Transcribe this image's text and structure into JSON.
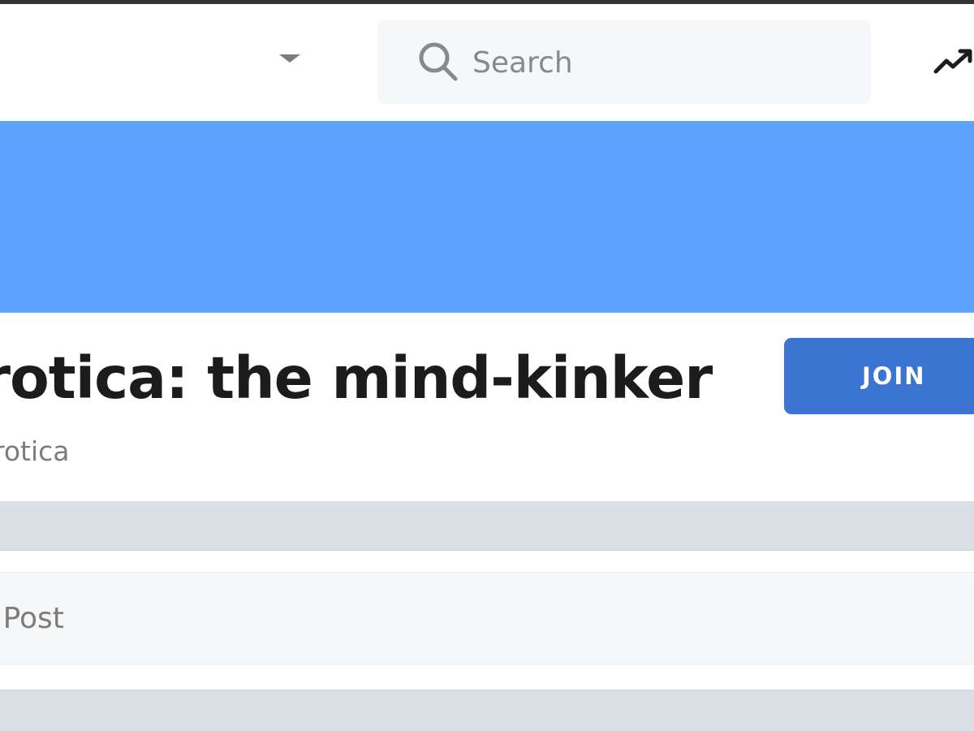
{
  "header": {
    "search": {
      "placeholder": "Search",
      "icon": "search-icon"
    },
    "dropdown_icon": "chevron-down-icon",
    "trending_icon": "trending-up-icon"
  },
  "banner": {
    "color": "#5ea3fd"
  },
  "community": {
    "title": "rotica: the mind-kinker",
    "name": "rotica",
    "join_label": "JOIN",
    "join_color": "#3b74d1"
  },
  "create_post": {
    "placeholder": "e Post"
  }
}
